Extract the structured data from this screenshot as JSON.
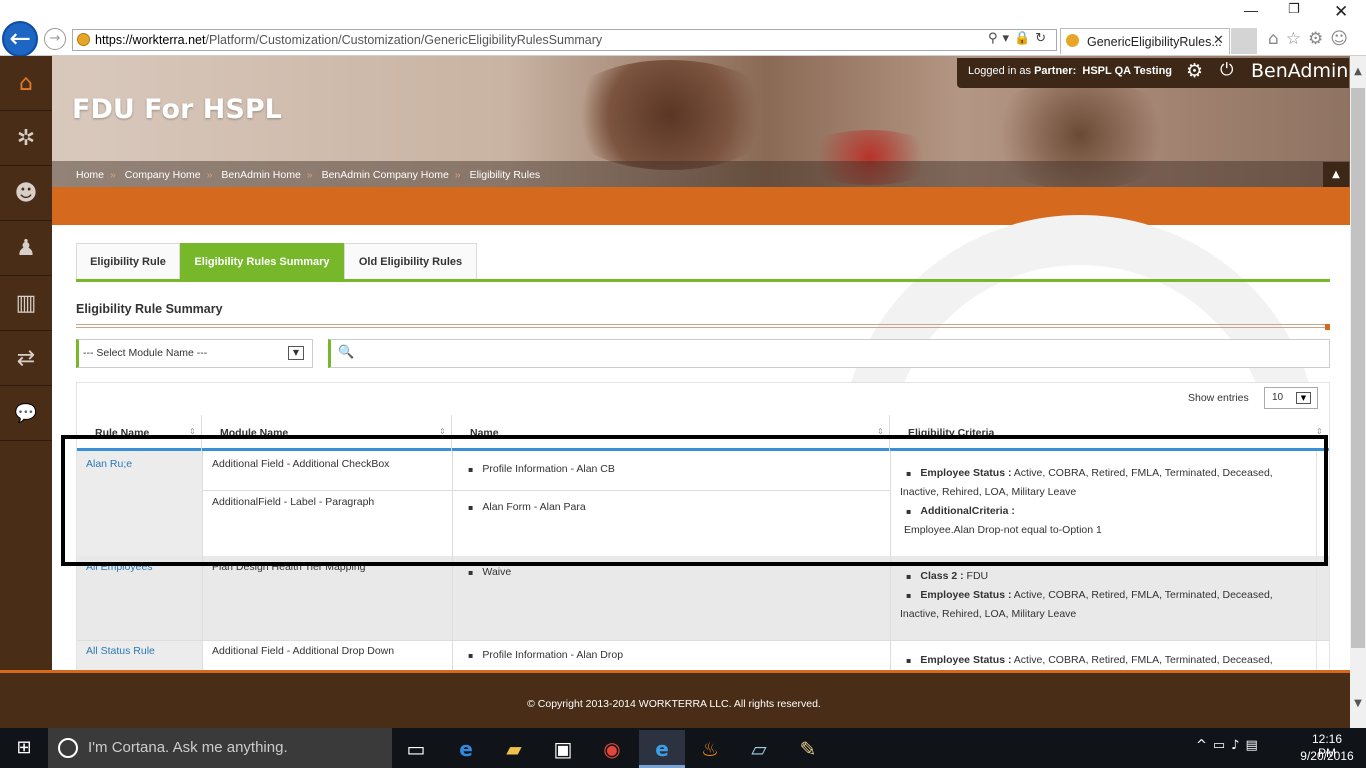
{
  "browser": {
    "url_domain": "https://workterra.net",
    "url_path": "/Platform/Customization/Customization/GenericEligibilityRulesSummary",
    "tab_title": "GenericEligibilityRules...",
    "tab_close": "✕",
    "min_glyph": "—",
    "max_glyph": "❐",
    "close_glyph": "✕",
    "back_glyph": "←",
    "fwd_glyph": "→",
    "addr_tools": "⚲▾🔒↻",
    "right_icons": "⌂☆⚙☺"
  },
  "sidebar": {
    "items": [
      {
        "icon": "home-icon",
        "glyph": "⌂"
      },
      {
        "icon": "puzzle-icon",
        "glyph": "✲"
      },
      {
        "icon": "user-star-icon",
        "glyph": "☻"
      },
      {
        "icon": "user-icon",
        "glyph": "♟"
      },
      {
        "icon": "chart-icon",
        "glyph": "▥"
      },
      {
        "icon": "transfer-icon",
        "glyph": "⇄"
      },
      {
        "icon": "chat-icon",
        "glyph": "💬"
      }
    ]
  },
  "header": {
    "company_title": "FDU For HSPL",
    "login_prefix": "Logged in as",
    "partner_label": "Partner:",
    "partner_name": "HSPL QA Testing",
    "brand": "BenAdmin",
    "gear": "⚙",
    "power": "⏻",
    "collapse": "▲"
  },
  "breadcrumb": [
    "Home",
    "Company Home",
    "BenAdmin Home",
    "BenAdmin Company Home",
    "Eligibility Rules"
  ],
  "breadcrumb_sep": "»",
  "tabs": [
    {
      "label": "Eligibility Rule",
      "active": false
    },
    {
      "label": "Eligibility Rules Summary",
      "active": true
    },
    {
      "label": "Old Eligibility Rules",
      "active": false
    }
  ],
  "section_title": "Eligibility Rule Summary",
  "filters": {
    "module_select": "--- Select Module Name ---",
    "select_arrow": "▼",
    "search_glyph": "🔍",
    "search_placeholder": ""
  },
  "table": {
    "show_entries_label": "Show entries",
    "entries_value": "10",
    "headers": [
      "Rule Name",
      "Module Name",
      "Name",
      "Eligibility Criteria"
    ],
    "sort_glyph": "⇕",
    "rows": [
      {
        "rule": "Alan Ru;e",
        "modules": [
          "Additional Field - Additional CheckBox",
          "AdditionalField - Label - Paragraph"
        ],
        "names": [
          "Profile Information - Alan CB",
          "Alan Form - Alan Para"
        ],
        "criteria": {
          "status_label": "Employee Status :",
          "status_line1": "Active, COBRA, Retired, FMLA, Terminated, Deceased,",
          "status_line2": "Inactive, Rehired, LOA, Military Leave",
          "additional_label": "AdditionalCriteria :",
          "additional_value": "Employee.Alan Drop-not equal to-Option 1"
        }
      },
      {
        "rule": "All Employees",
        "module": "Plan Design Health Tier Mapping",
        "name": "Waive",
        "criteria": {
          "class_label": "Class 2 :",
          "class_value": "FDU",
          "status_label": "Employee Status :",
          "status_line1": "Active, COBRA, Retired, FMLA, Terminated, Deceased,",
          "status_line2": "Inactive, Rehired, LOA, Military Leave"
        }
      },
      {
        "rule": "All Status Rule",
        "module": "Additional Field - Additional Drop Down",
        "name": "Profile Information - Alan Drop",
        "criteria": {
          "status_label": "Employee Status :",
          "status_line1": "Active, COBRA, Retired, FMLA, Terminated, Deceased,"
        }
      }
    ]
  },
  "footer": {
    "copyright": "© Copyright 2013-2014 WORKTERRA LLC. All rights reserved."
  },
  "taskbar": {
    "start_glyph": "⊞",
    "cortana_placeholder": "I'm Cortana. Ask me anything.",
    "apps": [
      {
        "icon": "task-view-icon",
        "glyph": "▭"
      },
      {
        "icon": "edge-icon",
        "glyph": "e"
      },
      {
        "icon": "file-explorer-icon",
        "glyph": "▰"
      },
      {
        "icon": "store-icon",
        "glyph": "▣"
      },
      {
        "icon": "chrome-icon",
        "glyph": "◉"
      },
      {
        "icon": "ie-icon",
        "glyph": "e"
      },
      {
        "icon": "firefox-icon",
        "glyph": "♨"
      },
      {
        "icon": "notepad-icon",
        "glyph": "▱"
      },
      {
        "icon": "paint-icon",
        "glyph": "✎"
      }
    ],
    "tray_icons": "^▭♪▤",
    "time": "12:16 PM",
    "date": "9/20/2016"
  },
  "colors": {
    "accent_green": "#76b82a",
    "accent_orange": "#d56a1f",
    "sidebar_brown": "#4a2d17",
    "link_blue": "#2a7ab8"
  }
}
